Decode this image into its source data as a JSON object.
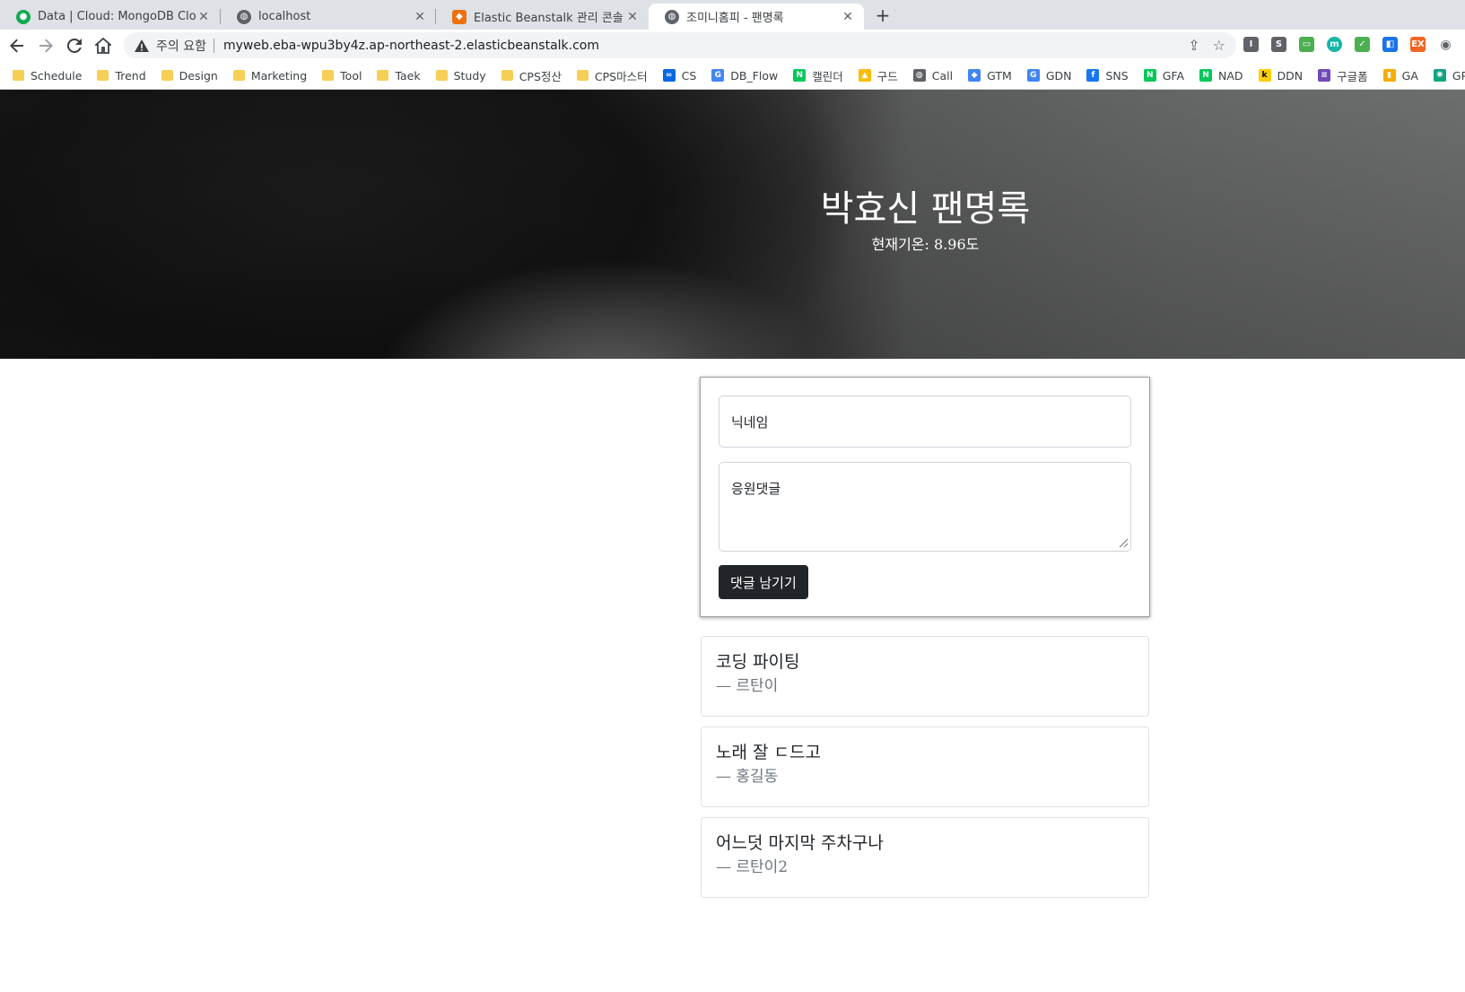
{
  "browser": {
    "tabs": [
      {
        "title": "Data | Cloud: MongoDB Cloud",
        "icon": "mongodb-leaf-icon",
        "color": "#13aa52"
      },
      {
        "title": "localhost",
        "icon": "globe-icon",
        "color": "#5f6368"
      },
      {
        "title": "Elastic Beanstalk 관리 콘솔",
        "icon": "aws-beanstalk-icon",
        "color": "#ec7211"
      },
      {
        "title": "조미니홈피 - 팬명록",
        "icon": "globe-icon",
        "color": "#5f6368"
      }
    ],
    "active_tab": 3,
    "address": {
      "security_label": "주의 요함",
      "url": "myweb.eba-wpu3by4z.ap-northeast-2.elasticbeanstalk.com"
    },
    "bookmarks": [
      {
        "label": "Schedule",
        "icon": "folder-icon"
      },
      {
        "label": "Trend",
        "icon": "folder-icon"
      },
      {
        "label": "Design",
        "icon": "folder-icon"
      },
      {
        "label": "Marketing",
        "icon": "folder-icon"
      },
      {
        "label": "Tool",
        "icon": "folder-icon"
      },
      {
        "label": "Taek",
        "icon": "folder-icon"
      },
      {
        "label": "Study",
        "icon": "folder-icon"
      },
      {
        "label": "CPS정산",
        "icon": "folder-icon"
      },
      {
        "label": "CPS마스터",
        "icon": "folder-icon"
      },
      {
        "label": "CS",
        "icon": "meta-icon"
      },
      {
        "label": "DB_Flow",
        "icon": "google-icon"
      },
      {
        "label": "캘린더",
        "icon": "naver-icon"
      },
      {
        "label": "구드",
        "icon": "google-drive-icon"
      },
      {
        "label": "Call",
        "icon": "globe-icon"
      },
      {
        "label": "GTM",
        "icon": "gtm-icon"
      },
      {
        "label": "GDN",
        "icon": "google-icon"
      },
      {
        "label": "SNS",
        "icon": "facebook-icon"
      },
      {
        "label": "GFA",
        "icon": "naver-icon"
      },
      {
        "label": "NAD",
        "icon": "naver-icon"
      },
      {
        "label": "DDN",
        "icon": "kakao-icon"
      },
      {
        "label": "구글폼",
        "icon": "google-forms-icon"
      },
      {
        "label": "GA",
        "icon": "analytics-icon"
      },
      {
        "label": "GPt",
        "icon": "openai-icon"
      }
    ]
  },
  "page": {
    "title": "박효신 팬명록",
    "weather": "현재기온: 8.96도",
    "form": {
      "nickname_placeholder": "닉네임",
      "comment_placeholder": "응원댓글",
      "submit_label": "댓글 남기기"
    },
    "comments": [
      {
        "text": "코딩 파이팅",
        "author": "— 르탄이"
      },
      {
        "text": "노래 잘 ㄷ드고",
        "author": "— 홍길동"
      },
      {
        "text": "어느덧 마지막 주차구나",
        "author": "— 르탄이2"
      }
    ]
  }
}
